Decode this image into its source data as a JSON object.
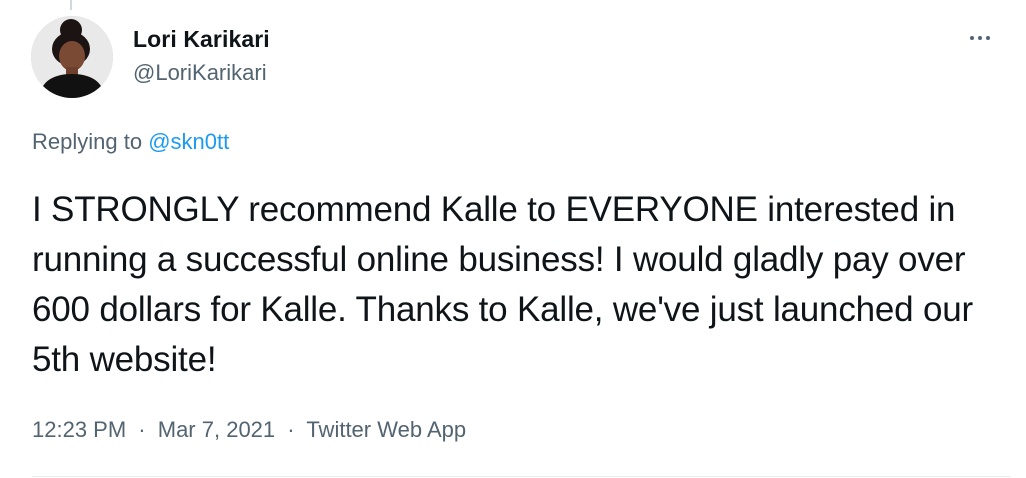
{
  "author": {
    "name": "Lori Karikari",
    "handle": "@LoriKarikari"
  },
  "reply": {
    "prefix": "Replying to",
    "mention": "@skn0tt"
  },
  "tweet": {
    "text": "I STRONGLY recommend Kalle to EVERYONE interested in running a successful online business! I would gladly pay over 600 dollars for Kalle. Thanks to Kalle, we've just launched our 5th website!"
  },
  "meta": {
    "time": "12:23 PM",
    "date": "Mar 7, 2021",
    "source": "Twitter Web App",
    "separator": "·"
  },
  "icons": {
    "more": "more-horizontal-icon"
  },
  "colors": {
    "text_primary": "#0f1419",
    "text_secondary": "#536471",
    "link": "#1d9bf0"
  }
}
